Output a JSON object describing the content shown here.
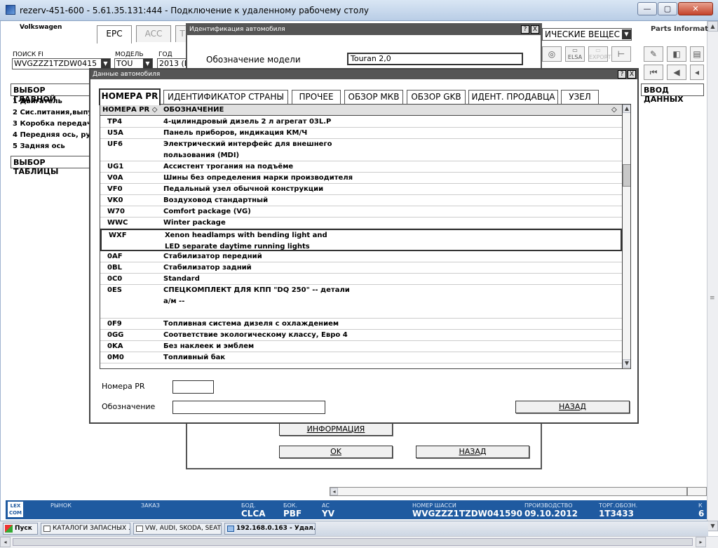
{
  "window": {
    "title": "rezerv-451-600 - 5.61.35.131:444 - Подключение к удаленному рабочему столу"
  },
  "app": {
    "brand": "Volkswagen",
    "tabs": [
      "EPC",
      "ACC",
      "T"
    ],
    "partsinfo": "Parts Informat",
    "chem": "ИЧЕСКИЕ ВЕЩЕС",
    "search_label": "ПОИСК FI",
    "search_value": "WVGZZZ1TZDW0415",
    "model_label": "МОДЕЛЬ",
    "model_value": "TOU",
    "year_label": "ГОД",
    "year_value": "2013 (D",
    "main_group_title": "ВЫБОР ГЛАВНОЙ",
    "main_groups": [
      "1  Двигатель",
      "2  Сис.питания,выпу",
      "3  Коробка передач",
      "4  Передняя ось, рул",
      "5  Задняя ось"
    ],
    "table_select": "ВЫБОР ТАБЛИЦЫ",
    "data_entry": "ВВОД ДАННЫХ",
    "toolbar_labels": {
      "elsa": "ELSA",
      "export": "EXPORT"
    }
  },
  "id_dialog": {
    "title": "Идентификация автомобиля",
    "help": "?",
    "close": "X",
    "model_label": "Обозначение модели",
    "model_value": "Touran 2,0",
    "info_button": "ИНФОРМАЦИЯ",
    "ok_button": "OK",
    "back_button": "НАЗАД"
  },
  "vd_dialog": {
    "title": "Данные автомобиля",
    "help": "?",
    "close": "X",
    "tabs": [
      "НОМЕРА PR",
      "ИДЕНТИФИКАТОР СТРАНЫ",
      "ПРОЧЕЕ",
      "ОБЗОР МКВ",
      "ОБЗОР GKB",
      "ИДЕНТ. ПРОДАВЦА",
      "УЗЕЛ"
    ],
    "col1": "НОМЕРА PR ◇",
    "col2": "ОБОЗНАЧЕНИЕ",
    "col2_icon": "◇",
    "rows": [
      {
        "code": "TP4",
        "desc": "4-цилиндровый дизель 2 л агрегат 03L.P"
      },
      {
        "code": "U5A",
        "desc": "Панель приборов, индикация КМ/Ч"
      },
      {
        "code": "UF6",
        "desc": "Электрический интерфейс для внешнего\nпользования (MDI)"
      },
      {
        "code": "UG1",
        "desc": "Ассистент трогания на подъёме"
      },
      {
        "code": "V0A",
        "desc": "Шины без определения марки производителя"
      },
      {
        "code": "VF0",
        "desc": "Педальный узел обычной конструкции"
      },
      {
        "code": "VK0",
        "desc": "Воздуховод стандартный"
      },
      {
        "code": "W70",
        "desc": "Comfort package (VG)"
      },
      {
        "code": "WWC",
        "desc": "Winter package"
      },
      {
        "code": "WXF",
        "desc": "Xenon headlamps with bending light and\nLED separate daytime running lights"
      },
      {
        "code": "0AF",
        "desc": "Стабилизатор передний"
      },
      {
        "code": "0BL",
        "desc": "Стабилизатор задний"
      },
      {
        "code": "0C0",
        "desc": "Standard"
      },
      {
        "code": "0ES",
        "desc": "СПЕЦКОМПЛЕКТ ДЛЯ КПП \"DQ 250\" -- детали\nа/м --"
      },
      {
        "code": "0F9",
        "desc": "Топливная система дизеля с охлаждением"
      },
      {
        "code": "0GG",
        "desc": "Соответствие экологическому классу, Евро 4"
      },
      {
        "code": "0KA",
        "desc": "Без наклеек и эмблем"
      },
      {
        "code": "0M0",
        "desc": "Топливный бак"
      }
    ],
    "pr_label": "Номера PR",
    "pr_value": "",
    "desc_label": "Обозначение",
    "desc_value": "",
    "back_button": "НАЗАД"
  },
  "status": {
    "market_label": "РЫНОК",
    "order_label": "ЗАКАЗ",
    "bod_label": "БОД.",
    "bod_value": "CLCA",
    "bok_label": "БОК.",
    "bok_value": "PBF",
    "ac_label": "AC",
    "ac_value": "YV",
    "vin_label": "НОМЕР ШАССИ",
    "vin_value": "WVGZZZ1TZDW041590",
    "prod_label": "ПРОИЗВОДСТВО",
    "prod_value": "09.10.2012",
    "trade_label": "ТОРГ.ОБОЗН.",
    "trade_value": "1T3433",
    "k_label": "К",
    "k_value": "6",
    "logo_top": "LEX",
    "logo_bot": "COM"
  },
  "taskbar": {
    "start": "Пуск",
    "items": [
      "КАТАЛОГИ ЗАПАСНЫХ ...",
      "VW, AUDI, SKODA, SEAT",
      "192.168.0.163 - Удал..."
    ]
  },
  "colors": {
    "status_bar": "#1f5aa0",
    "dialog_header": "#555555"
  }
}
